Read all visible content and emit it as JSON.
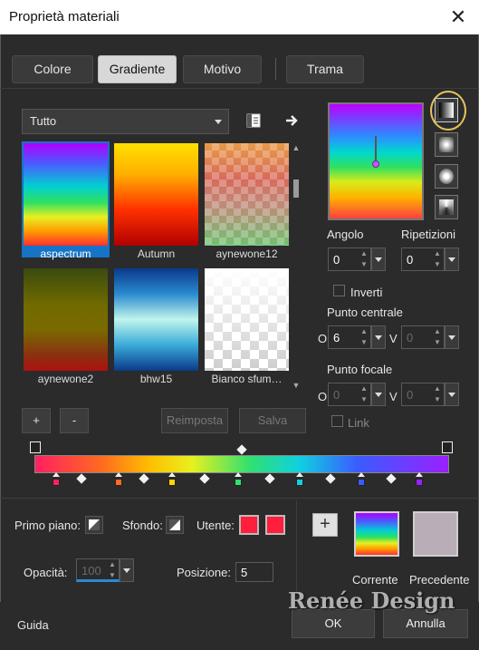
{
  "window": {
    "title": "Proprietà materiali",
    "close_glyph": "✕"
  },
  "tabs": [
    {
      "label": "Colore",
      "active": false
    },
    {
      "label": "Gradiente",
      "active": true
    },
    {
      "label": "Motivo",
      "active": false
    },
    {
      "label": "Trama",
      "active": false
    }
  ],
  "library": {
    "category_value": "Tutto",
    "items": [
      {
        "label": "aspectrum",
        "selected": true
      },
      {
        "label": "Autumn",
        "selected": false
      },
      {
        "label": "aynewone12",
        "selected": false
      },
      {
        "label": "aynewone2",
        "selected": false
      },
      {
        "label": "bhw15",
        "selected": false
      },
      {
        "label": "Bianco sfum…",
        "selected": false
      }
    ],
    "add_label": "+",
    "remove_label": "-",
    "reset_label": "Reimposta",
    "save_label": "Salva"
  },
  "gradient_settings": {
    "angle_label": "Angolo",
    "angle_value": "0",
    "repeats_label": "Ripetizioni",
    "repeats_value": "0",
    "invert_label": "Inverti",
    "center_label": "Punto centrale",
    "center_h_label": "O",
    "center_h_value": "6",
    "center_v_label": "V",
    "center_v_value": "0",
    "focal_label": "Punto focale",
    "focal_h_label": "O",
    "focal_h_value": "0",
    "focal_v_label": "V",
    "focal_v_value": "0",
    "link_label": "Link"
  },
  "bottom": {
    "foreground_label": "Primo piano:",
    "background_label": "Sfondo:",
    "user_label": "Utente:",
    "user_color": "#ff1e3c",
    "opacity_label": "Opacità:",
    "opacity_value": "100",
    "position_label": "Posizione:",
    "position_value": "5",
    "current_label": "Corrente",
    "previous_label": "Precedente",
    "previous_color": "#b9adb7",
    "add_glyph": "+"
  },
  "footer": {
    "help_label": "Guida",
    "ok_label": "OK",
    "cancel_label": "Annulla"
  },
  "watermark": "Renée Design",
  "colors": {
    "accent": "#1673c6",
    "ring": "#e8c35a",
    "stops": [
      "#ff2060",
      "#ff6a20",
      "#ffd200",
      "#30e070",
      "#10d0e0",
      "#3a5cff",
      "#9a20ff"
    ]
  }
}
